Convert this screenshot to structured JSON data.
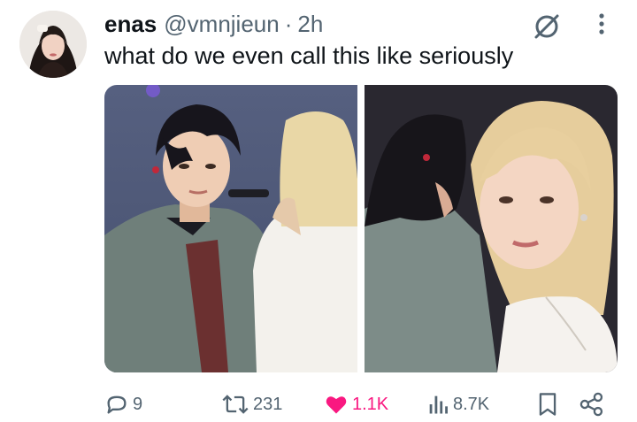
{
  "author": {
    "display_name": "enas",
    "handle": "@vmnjieun",
    "separator": "·",
    "time": "2h"
  },
  "tweet": {
    "text": "what do we even call this like seriously"
  },
  "actions": {
    "replies": "9",
    "retweets": "231",
    "likes": "1.1K",
    "views": "8.7K"
  },
  "colors": {
    "like_active": "#f91880",
    "muted": "#536471",
    "text": "#0f1419"
  },
  "icons": {
    "reply": "reply-icon",
    "retweet": "retweet-icon",
    "like": "heart-icon",
    "views": "views-icon",
    "bookmark": "bookmark-icon",
    "share": "share-icon",
    "grok": "grok-icon",
    "more": "more-icon"
  }
}
